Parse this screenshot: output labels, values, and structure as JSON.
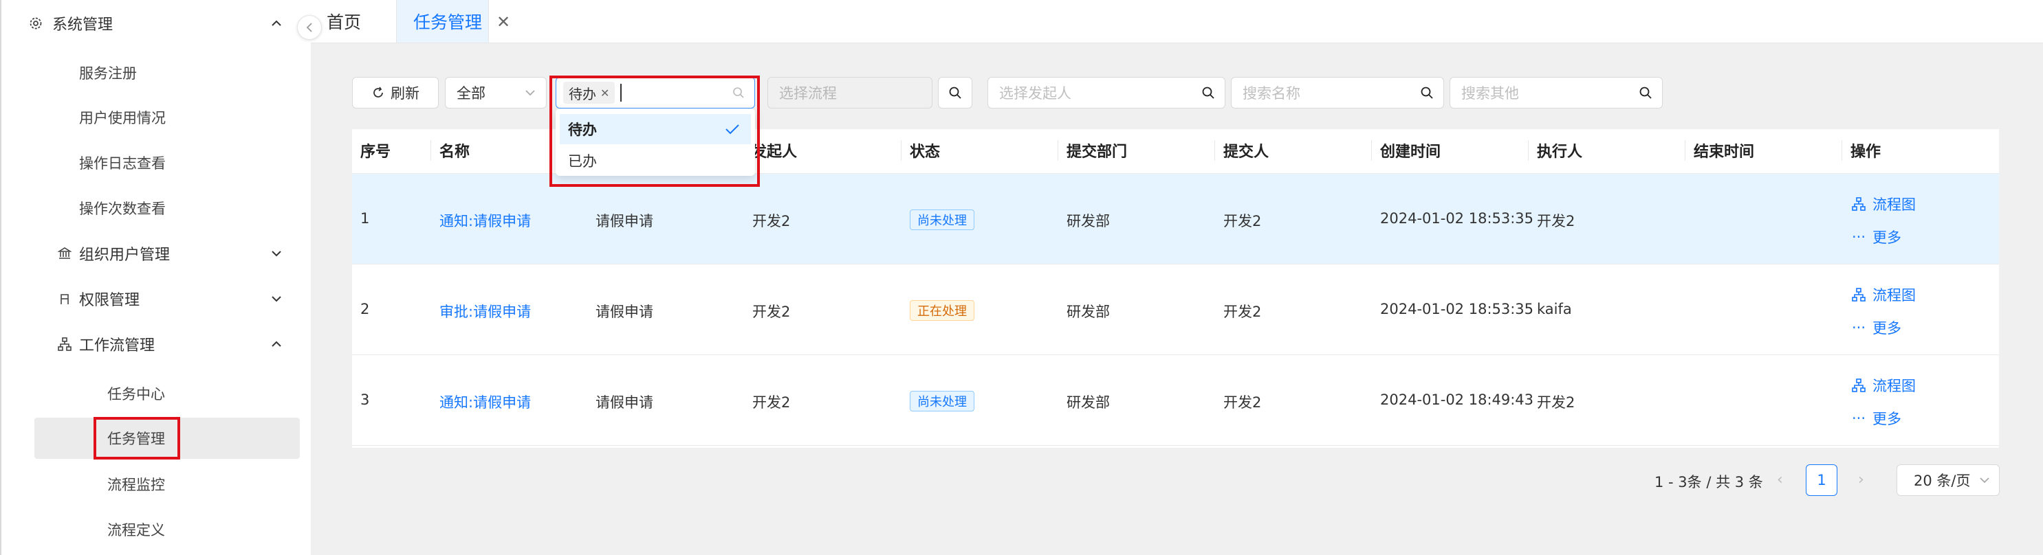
{
  "sidebar": {
    "system": {
      "label": "系统管理",
      "icon": "gear-icon"
    },
    "items": [
      {
        "label": "服务注册"
      },
      {
        "label": "用户使用情况"
      },
      {
        "label": "操作日志查看"
      },
      {
        "label": "操作次数查看"
      }
    ],
    "org": {
      "label": "组织用户管理",
      "icon": "bank-icon"
    },
    "perm": {
      "label": "权限管理",
      "icon": "user-icon"
    },
    "workflow": {
      "label": "工作流管理",
      "icon": "hierarchy-icon"
    },
    "workflow_items": [
      {
        "label": "任务中心"
      },
      {
        "label": "任务管理"
      },
      {
        "label": "流程监控"
      },
      {
        "label": "流程定义"
      }
    ]
  },
  "tabs": {
    "home": "首页",
    "active": "任务管理"
  },
  "toolbar": {
    "refresh": "刷新",
    "scope_select": "全部",
    "status_tag": "待办",
    "process_placeholder": "选择流程",
    "initiator_placeholder": "选择发起人",
    "name_placeholder": "搜索名称",
    "other_placeholder": "搜索其他"
  },
  "dropdown": {
    "options": [
      "待办",
      "已办"
    ],
    "selected": "待办"
  },
  "table": {
    "headers": [
      "序号",
      "名称",
      "",
      "发起人",
      "状态",
      "提交部门",
      "提交人",
      "创建时间",
      "执行人",
      "结束时间",
      "操作"
    ],
    "rows": [
      {
        "no": "1",
        "name": "通知:请假申请",
        "process": "请假申请",
        "initiator": "开发2",
        "status": "尚未处理",
        "dept": "研发部",
        "submitter": "开发2",
        "created": "2024-01-02 18:53:35",
        "executor": "开发2",
        "ended": ""
      },
      {
        "no": "2",
        "name": "审批:请假申请",
        "process": "请假申请",
        "initiator": "开发2",
        "status": "正在处理",
        "dept": "研发部",
        "submitter": "开发2",
        "created": "2024-01-02 18:53:35",
        "executor": "kaifa",
        "ended": ""
      },
      {
        "no": "3",
        "name": "通知:请假申请",
        "process": "请假申请",
        "initiator": "开发2",
        "status": "尚未处理",
        "dept": "研发部",
        "submitter": "开发2",
        "created": "2024-01-02 18:49:43",
        "executor": "开发2",
        "ended": ""
      }
    ],
    "op_flow": "流程图",
    "op_more": "更多"
  },
  "pagination": {
    "summary": "1 - 3条 / 共 3 条",
    "current": "1",
    "page_size": "20 条/页"
  },
  "colors": {
    "accent": "#1677ff",
    "highlight_row": "#e6f4ff",
    "red_box": "#e0101a"
  }
}
